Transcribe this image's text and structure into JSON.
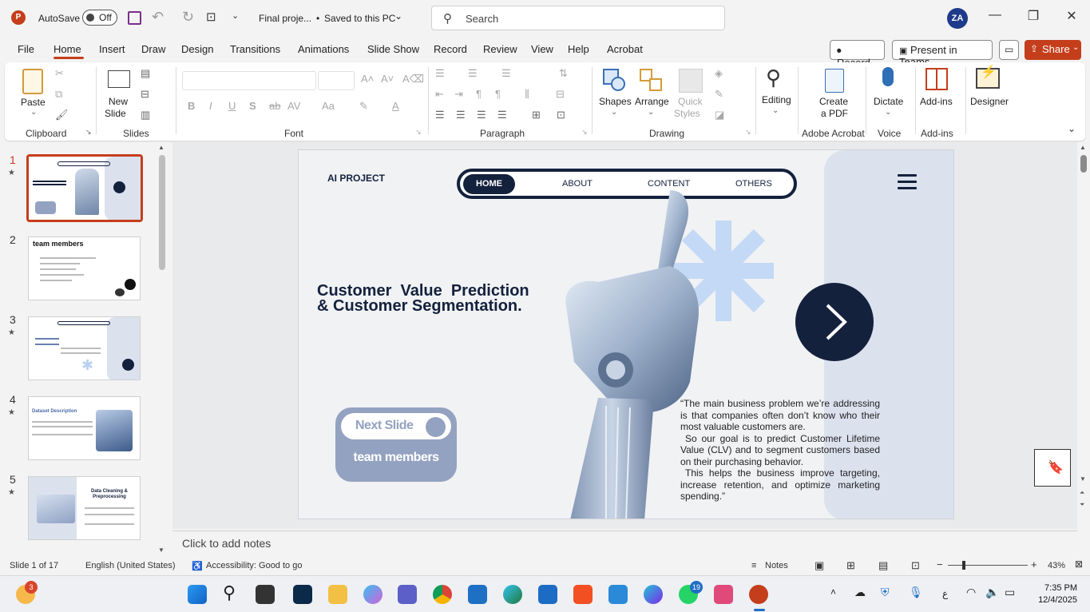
{
  "app": {
    "autosave_label": "AutoSave",
    "autosave_state": "Off",
    "doc_title": "Final proje...",
    "save_status": "Saved to this PC",
    "search_placeholder": "Search",
    "user_initials": "ZA",
    "brand_color": "#c43e1c"
  },
  "menu": {
    "tabs": [
      "File",
      "Home",
      "Insert",
      "Draw",
      "Design",
      "Transitions",
      "Animations",
      "Slide Show",
      "Record",
      "Review",
      "View",
      "Help",
      "Acrobat"
    ],
    "active_tab": "Home",
    "record_label": "Record",
    "present_label": "Present in Teams",
    "share_label": "Share"
  },
  "ribbon": {
    "groups": {
      "clipboard": "Clipboard",
      "slides": "Slides",
      "font": "Font",
      "paragraph": "Paragraph",
      "drawing": "Drawing",
      "acrobat": "Adobe Acrobat",
      "voice": "Voice",
      "addins": "Add-ins"
    },
    "paste": "Paste",
    "new_slide_1": "New",
    "new_slide_2": "Slide",
    "shapes": "Shapes",
    "arrange": "Arrange",
    "quick_styles_1": "Quick",
    "quick_styles_2": "Styles",
    "editing": "Editing",
    "create_pdf_1": "Create",
    "create_pdf_2": "a PDF",
    "dictate": "Dictate",
    "addins": "Add-ins",
    "designer": "Designer"
  },
  "thumbnails": [
    {
      "num": "1",
      "star": true,
      "selected": true
    },
    {
      "num": "2",
      "star": false,
      "selected": false,
      "title": "team members"
    },
    {
      "num": "3",
      "star": true,
      "selected": false
    },
    {
      "num": "4",
      "star": true,
      "selected": false,
      "title": "Dataset Description"
    },
    {
      "num": "5",
      "star": true,
      "selected": false,
      "title": "Data Cleaning & Preprocessing"
    }
  ],
  "slide": {
    "brand": "AI PROJECT",
    "nav": [
      "HOME",
      "ABOUT",
      "CONTENT",
      "OTHERS"
    ],
    "title_line1": "Customer  Value  Prediction",
    "title_line2": "& Customer Segmentation.",
    "quote_p1": "“The main business problem we’re addressing is that companies often don’t know who their most valuable customers are.",
    "quote_p2": "So our goal is to predict Customer Lifetime Value (CLV) and to segment customers based on their purchasing behavior.",
    "quote_p3": "This helps the business improve targeting, increase retention, and optimize marketing spending.”",
    "next_slide": "Next Slide",
    "team_members": "team members",
    "navy": "#14213d",
    "accent_blue": "#93a2c0"
  },
  "notes_placeholder": "Click to add notes",
  "status": {
    "slide_count": "Slide 1 of 17",
    "language": "English (United States)",
    "accessibility": "Accessibility: Good to go",
    "notes": "Notes",
    "zoom": "43%"
  },
  "taskbar": {
    "weather_badge": "3",
    "whatsapp_badge": "19",
    "input_lang": "ع",
    "time": "7:35 PM",
    "date": "12/4/2025"
  }
}
